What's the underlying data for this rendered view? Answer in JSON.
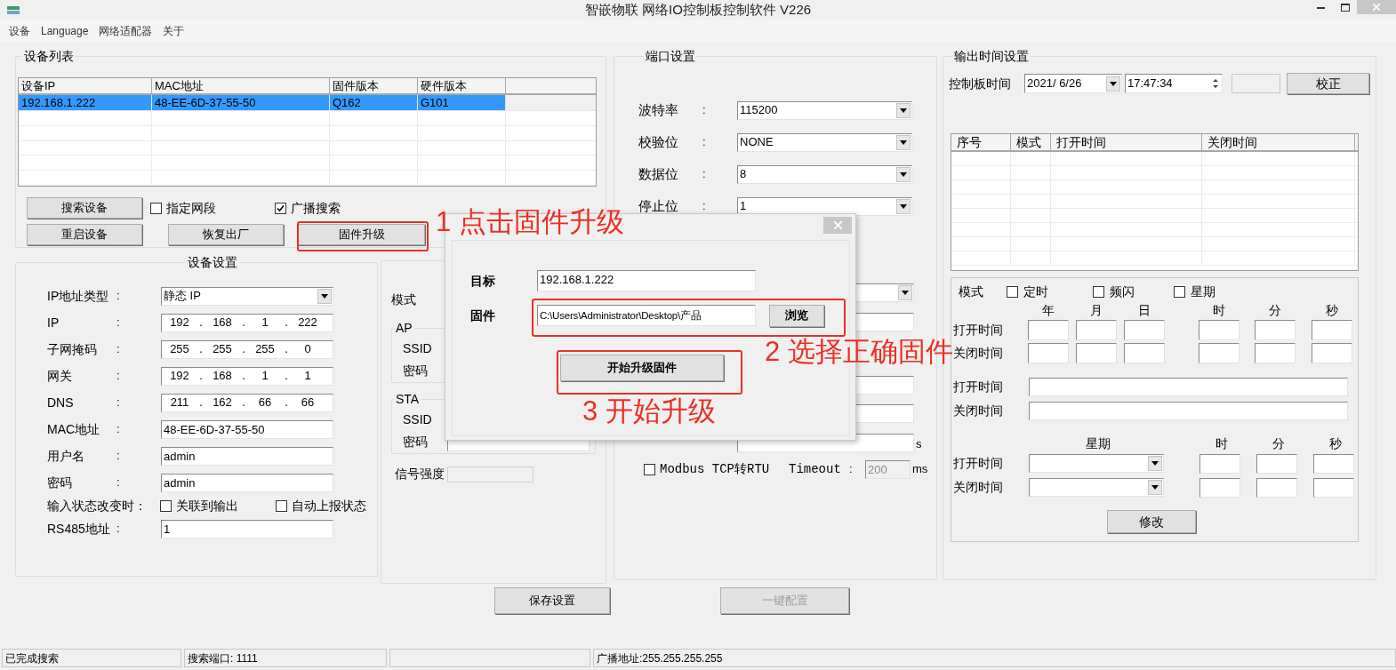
{
  "window": {
    "title": "智嵌物联 网络IO控制板控制软件   V226"
  },
  "menu": [
    {
      "label": "设备"
    },
    {
      "label": "Language"
    },
    {
      "label": "网络适配器"
    },
    {
      "label": "关于"
    }
  ],
  "device_list": {
    "title": "设备列表",
    "columns": [
      "设备IP",
      "MAC地址",
      "固件版本",
      "硬件版本"
    ],
    "rows": [
      {
        "cells": [
          "192.168.1.222",
          "48-EE-6D-37-55-50",
          "Q162",
          "G101"
        ],
        "selected": true
      }
    ],
    "toolbar_rows": [
      {
        "items": [
          {
            "kind": "button",
            "label": "搜索设备"
          },
          {
            "kind": "checkbox",
            "label": "指定网段",
            "checked": false
          },
          {
            "kind": "checkbox",
            "label": "广播搜索",
            "checked": true
          }
        ]
      },
      {
        "items": [
          {
            "kind": "button",
            "label": "重启设备"
          },
          {
            "kind": "button",
            "label": "恢复出厂"
          },
          {
            "kind": "button",
            "label": "固件升级"
          }
        ]
      }
    ]
  },
  "device_settings": {
    "title": "设备设置",
    "rows": [
      {
        "kind": "select",
        "label": "IP地址类型",
        "colon": ":",
        "value": "静态 IP"
      },
      {
        "kind": "ip",
        "label": "IP",
        "colon": ":",
        "octets": [
          "192",
          "168",
          "1",
          "222"
        ],
        "separator": "."
      },
      {
        "kind": "ip",
        "label": "子网掩码",
        "colon": ":",
        "octets": [
          "255",
          "255",
          "255",
          "0"
        ],
        "separator": "."
      },
      {
        "kind": "ip",
        "label": "网关",
        "colon": ":",
        "octets": [
          "192",
          "168",
          "1",
          "1"
        ],
        "separator": "."
      },
      {
        "kind": "ip",
        "label": "DNS",
        "colon": ":",
        "octets": [
          "211",
          "162",
          "66",
          "66"
        ],
        "separator": "."
      },
      {
        "kind": "field",
        "label": "MAC地址",
        "colon": ":",
        "value": "48-EE-6D-37-55-50"
      },
      {
        "kind": "field",
        "label": "用户名",
        "colon": ":",
        "value": "admin"
      },
      {
        "kind": "field",
        "label": "密码",
        "colon": ":",
        "value": "admin"
      },
      {
        "kind": "checks",
        "label": "输入状态改变时：",
        "options": [
          {
            "label": "关联到输出",
            "checked": false
          },
          {
            "label": "自动上报状态",
            "checked": false
          }
        ]
      },
      {
        "kind": "field",
        "label": "RS485地址",
        "colon": ":",
        "value": "1"
      }
    ]
  },
  "wifi": {
    "mode_label": "模式",
    "groups": [
      {
        "title": "AP",
        "fields": [
          {
            "label": "SSID"
          },
          {
            "label": "密码"
          }
        ]
      },
      {
        "title": "STA",
        "fields": [
          {
            "label": "SSID"
          },
          {
            "label": "密码",
            "input": true
          }
        ]
      }
    ],
    "signal": {
      "label": "信号强度"
    }
  },
  "port_settings": {
    "title": "端口设置",
    "rows": [
      {
        "label": "波特率",
        "colon": ":",
        "value": "115200"
      },
      {
        "label": "校验位",
        "colon": ":",
        "value": "NONE"
      },
      {
        "label": "数据位",
        "colon": ":",
        "value": "8"
      },
      {
        "label": "停止位",
        "colon": ":",
        "value": "1"
      }
    ],
    "covered_controls": [
      {
        "kind": "select"
      },
      {
        "kind": "field"
      },
      {
        "kind": "field"
      },
      {
        "kind": "field"
      },
      {
        "kind": "field",
        "unit": "s"
      }
    ],
    "modbus": {
      "label": "Modbus TCP转RTU",
      "checked": false
    },
    "timeout": {
      "label": "Timeout",
      "colon": ":",
      "value": "200",
      "unit": "ms",
      "disabled": true
    }
  },
  "output_time": {
    "title": "输出时间设置",
    "clock": {
      "label": "控制板时间",
      "date": "2021/ 6/26",
      "time": "17:47:34"
    },
    "correct_button": "校正",
    "table": {
      "columns": [
        "序号",
        "模式",
        "打开时间",
        "关闭时间"
      ]
    },
    "mode": {
      "label": "模式",
      "options": [
        {
          "label": "定时",
          "checked": false
        },
        {
          "label": "频闪",
          "checked": false
        },
        {
          "label": "星期",
          "checked": false
        }
      ]
    },
    "date_headers": [
      "年",
      "月",
      "日",
      "时",
      "分",
      "秒"
    ],
    "date_rows": [
      "打开时间",
      "关闭时间"
    ],
    "long_rows": [
      "打开时间",
      "关闭时间"
    ],
    "week_headers": [
      "星期",
      "时",
      "分",
      "秒"
    ],
    "week_rows": [
      "打开时间",
      "关闭时间"
    ],
    "modify_button": "修改"
  },
  "buttons": [
    {
      "label": "保存设置",
      "disabled": false
    },
    {
      "label": "一键配置",
      "disabled": true
    }
  ],
  "status_bar": [
    {
      "kind": "text",
      "text": "已完成搜索"
    },
    {
      "kind": "text",
      "text": "搜索端口: 1111"
    },
    {
      "kind": "blank"
    },
    {
      "kind": "text",
      "text": "广播地址:255.255.255.255"
    }
  ],
  "dialog": {
    "target": {
      "label": "目标",
      "value": "192.168.1.222"
    },
    "firmware": {
      "label": "固件",
      "value": "C:\\Users\\Administrator\\Desktop\\产品"
    },
    "browse": "浏览",
    "start": "开始升级固件"
  },
  "annotations": [
    {
      "text": "1 点击固件升级"
    },
    {
      "text": "2 选择正确固件"
    },
    {
      "text": "3 开始升级"
    }
  ]
}
